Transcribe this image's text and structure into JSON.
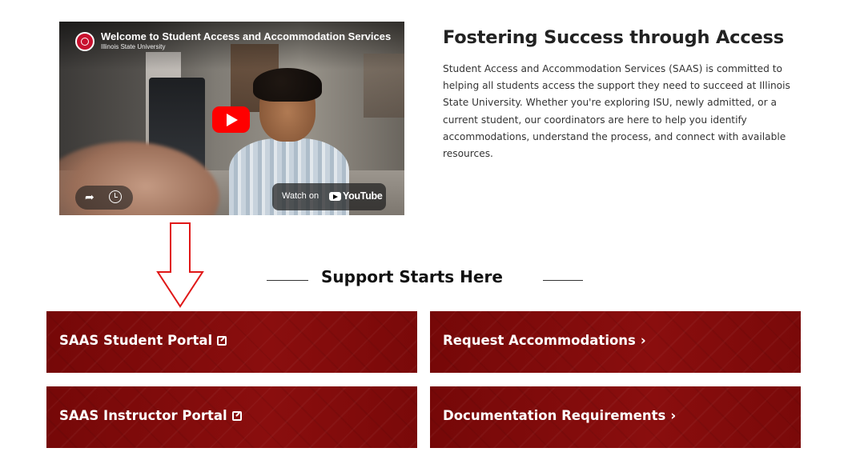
{
  "video": {
    "title": "Welcome to Student Access and Accommodation Services",
    "channel": "Illinois State University",
    "watch_on": "Watch on",
    "youtube_brand": "YouTube"
  },
  "intro": {
    "heading": "Fostering Success through Access",
    "body": "Student Access and Accommodation Services (SAAS) is committed to helping all students access the support they need to succeed at Illinois State University. Whether you're exploring ISU, newly admitted, or a current student, our coordinators are here to help you identify accommodations, understand the process, and connect with available resources."
  },
  "support": {
    "heading": "Support Starts Here",
    "buttons": [
      {
        "label": "SAAS Student Portal",
        "icon": "external-link-icon"
      },
      {
        "label": "Request Accommodations",
        "icon": "chevron-right-icon",
        "glyph": "›"
      },
      {
        "label": "SAAS Instructor Portal",
        "icon": "external-link-icon"
      },
      {
        "label": "Documentation Requirements",
        "icon": "chevron-right-icon",
        "glyph": "›"
      }
    ]
  },
  "colors": {
    "button_bg": "#7f0a0a",
    "arrow_red": "#e01818",
    "youtube_red": "#ff0000"
  }
}
